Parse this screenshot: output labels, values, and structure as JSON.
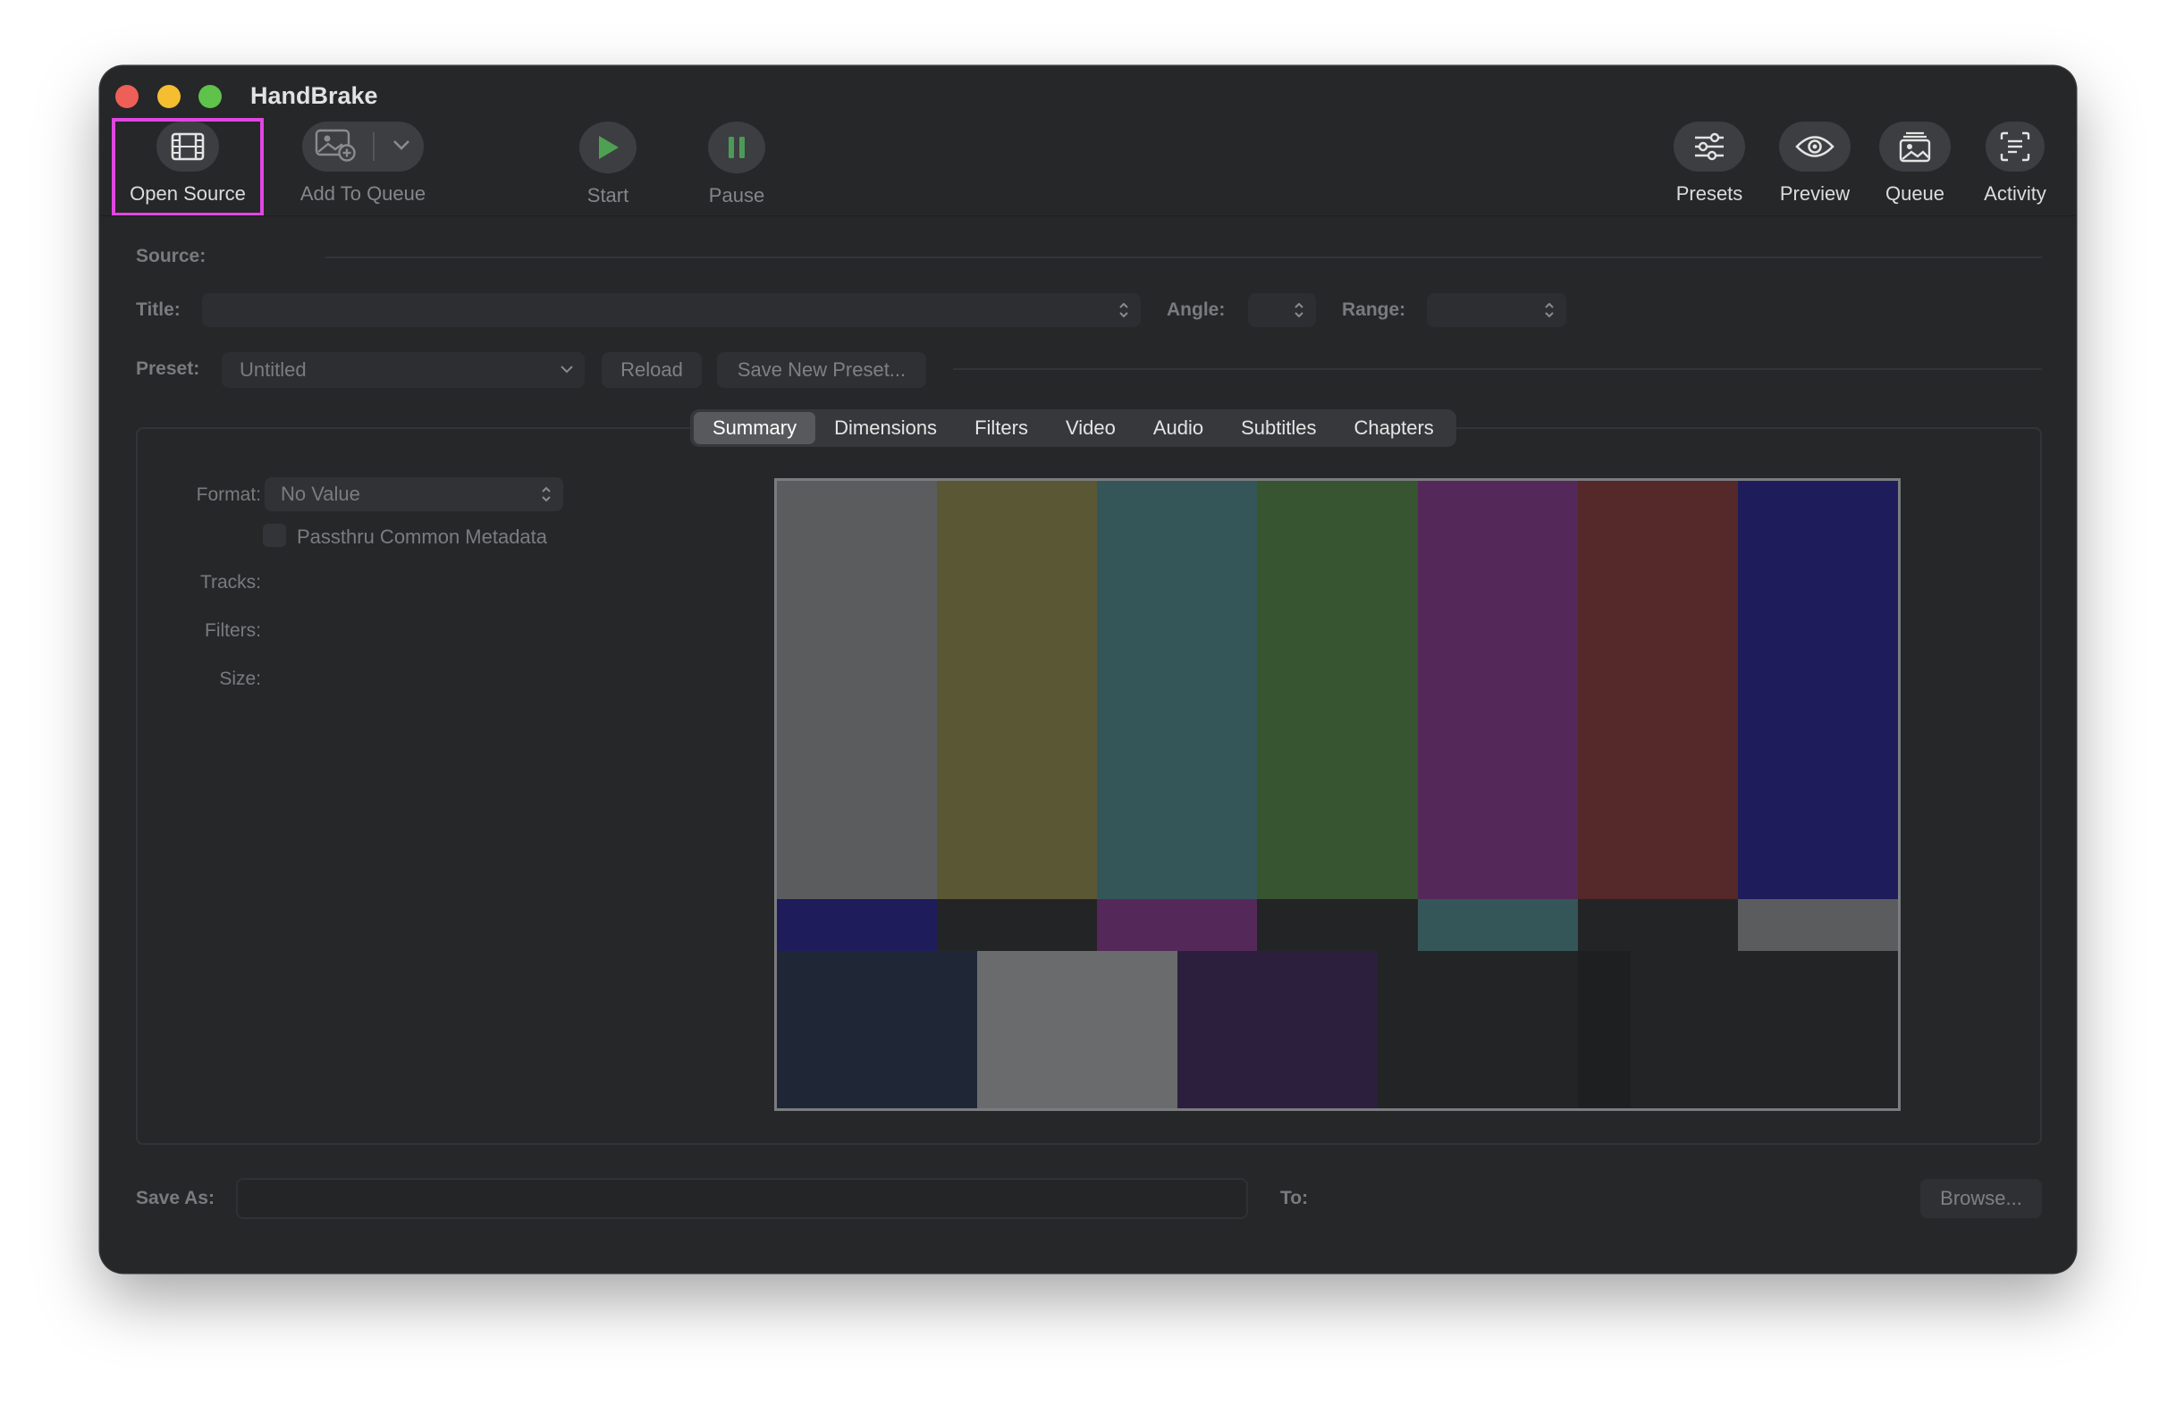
{
  "window": {
    "title": "HandBrake"
  },
  "toolbar": {
    "open_source": {
      "label": "Open Source",
      "icon": "film-icon"
    },
    "add_to_queue": {
      "label": "Add To Queue",
      "icon": "add-photo-icon"
    },
    "start": {
      "label": "Start",
      "icon": "play-icon"
    },
    "pause": {
      "label": "Pause",
      "icon": "pause-icon"
    },
    "presets": {
      "label": "Presets",
      "icon": "sliders-icon"
    },
    "preview": {
      "label": "Preview",
      "icon": "eye-icon"
    },
    "queue": {
      "label": "Queue",
      "icon": "photo-stack-icon"
    },
    "activity": {
      "label": "Activity",
      "icon": "activity-log-icon"
    }
  },
  "source": {
    "label": "Source:"
  },
  "title_row": {
    "title_label": "Title:",
    "angle_label": "Angle:",
    "range_label": "Range:"
  },
  "preset_row": {
    "label": "Preset:",
    "value": "Untitled",
    "reload": "Reload",
    "save_new": "Save New Preset..."
  },
  "tabs": [
    "Summary",
    "Dimensions",
    "Filters",
    "Video",
    "Audio",
    "Subtitles",
    "Chapters"
  ],
  "active_tab": "Summary",
  "summary": {
    "format_label": "Format:",
    "format_value": "No Value",
    "passthru_label": "Passthru Common Metadata",
    "tracks_label": "Tracks:",
    "filters_label": "Filters:",
    "size_label": "Size:"
  },
  "bottom": {
    "save_as_label": "Save As:",
    "to_label": "To:",
    "browse": "Browse..."
  },
  "colors": {
    "accent_highlight": "#e046e0",
    "window_bg": "#262729",
    "play_green": "#4ea153",
    "pause_green": "#4c9a58",
    "color_bars_top": [
      "#5b5c5e",
      "#5a5734",
      "#355658",
      "#365530",
      "#54295a",
      "#552829",
      "#1e1c5b"
    ],
    "color_bars_mid": [
      "#1e1c5b",
      "#232425",
      "#54295a",
      "#232425",
      "#355658",
      "#232425",
      "#5b5c5e"
    ],
    "color_bars_bottom": [
      "#1f2737",
      "#6a6b6d",
      "#2c1f3d",
      "#232425",
      "#1e1f20",
      "#232425",
      "#232425"
    ]
  }
}
